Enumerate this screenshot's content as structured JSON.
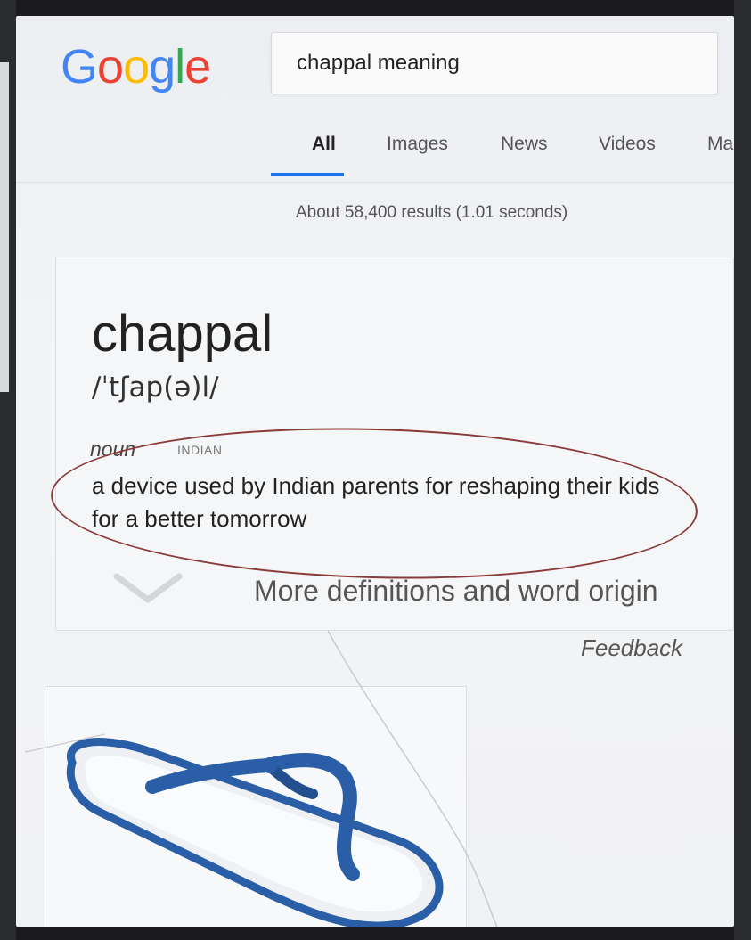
{
  "logo": {
    "letters": [
      "G",
      "o",
      "o",
      "g",
      "l",
      "e"
    ]
  },
  "search": {
    "query": "chappal meaning"
  },
  "tabs": [
    {
      "label": "All",
      "active": true
    },
    {
      "label": "Images"
    },
    {
      "label": "News"
    },
    {
      "label": "Videos"
    },
    {
      "label": "Ma"
    }
  ],
  "results_stats": "About 58,400 results (1.01 seconds)",
  "dictionary": {
    "word": "chappal",
    "pronunciation": "/ˈtʃap(ə)l/",
    "part_of_speech": "noun",
    "region": "INDIAN",
    "definition": "a device used by Indian parents for reshaping their kids for a better tomorrow",
    "more_link": "More definitions and word origin"
  },
  "feedback": "Feedback",
  "colors": {
    "google_blue": "#4285f4",
    "google_red": "#ea4335",
    "google_yellow": "#fbbc05",
    "google_green": "#34a853",
    "tab_accent": "#1a73e8",
    "annotation_circle": "#8b3a3a",
    "sandal_strap": "#2a5fa8"
  },
  "image_result": {
    "icon": "flip-flop-sandal-image"
  }
}
